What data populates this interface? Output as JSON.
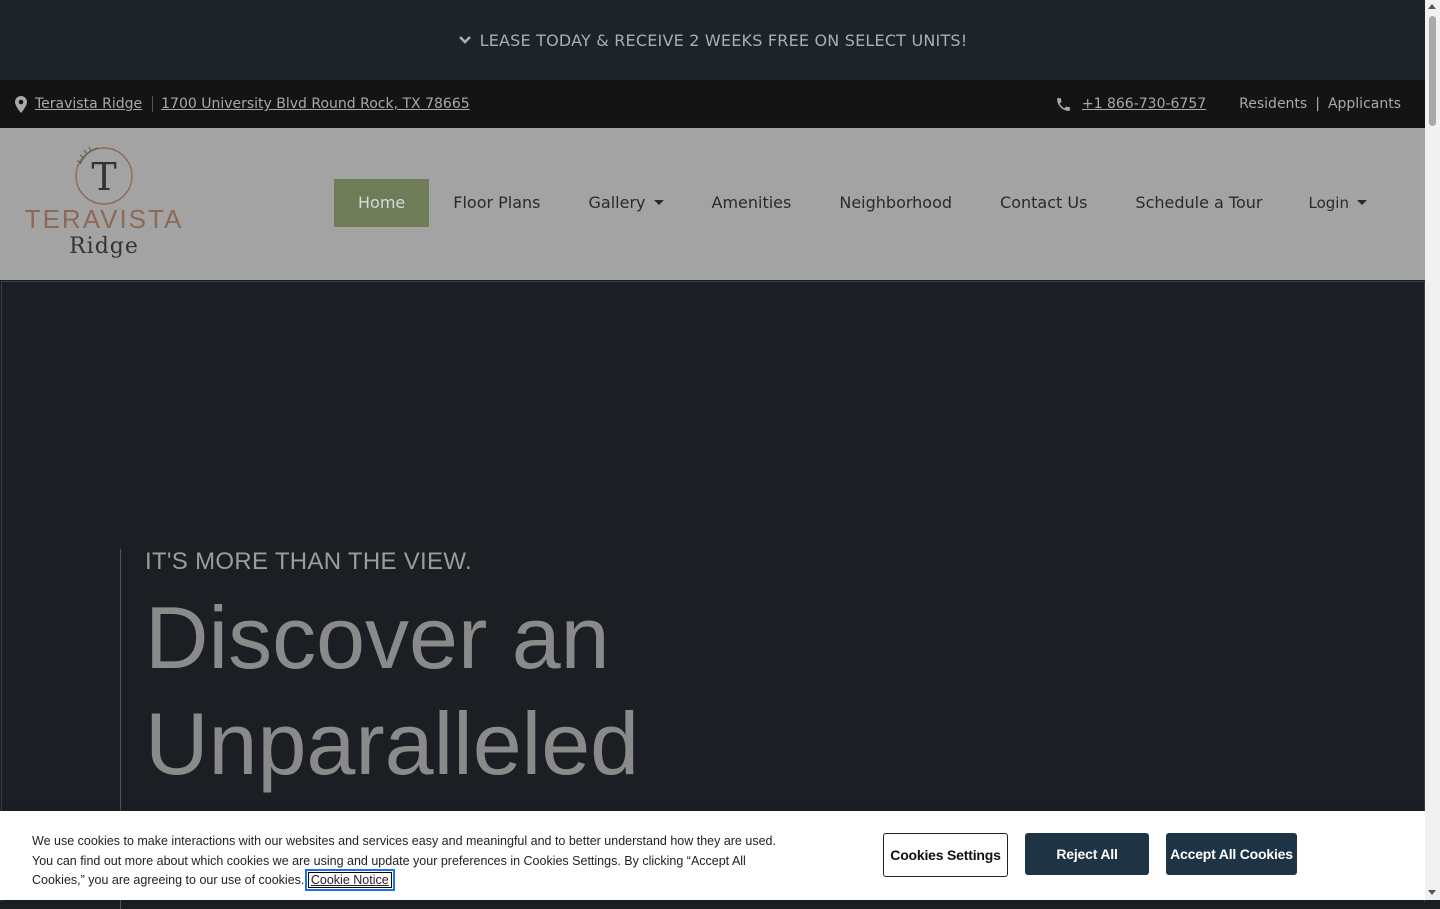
{
  "banner": {
    "text": "LEASE TODAY & RECEIVE 2 WEEKS FREE ON SELECT UNITS!",
    "icon": "chevron-down-icon"
  },
  "topbar": {
    "property_name": "Teravista Ridge",
    "address": "1700 University Blvd Round Rock, TX 78665",
    "phone": "+1 866-730-6757",
    "residents": "Residents",
    "separator": "|",
    "applicants": "Applicants"
  },
  "logo": {
    "line1": "TERAVISTA",
    "line2": "Ridge",
    "monogram": "T"
  },
  "nav": {
    "items": [
      {
        "label": "Home",
        "active": true
      },
      {
        "label": "Floor Plans"
      },
      {
        "label": "Gallery",
        "dropdown": true
      },
      {
        "label": "Amenities"
      },
      {
        "label": "Neighborhood"
      },
      {
        "label": "Contact Us"
      },
      {
        "label": "Schedule a Tour"
      }
    ],
    "login": "Login"
  },
  "hero": {
    "kicker": "IT'S MORE THAN THE VIEW.",
    "headline_line1": "Discover an",
    "headline_line2": "Unparalleled"
  },
  "cookie": {
    "text": "We use cookies to make interactions with our websites and services easy and meaningful and to better understand how they are used. You can find out more about which cookies we are using and update your preferences in Cookies Settings. By clicking “Accept All Cookies,” you are agreeing to our use of cookies.",
    "notice_link": "Cookie Notice",
    "settings_label": "Cookies Settings",
    "reject_label": "Reject All",
    "accept_label": "Accept All Cookies"
  },
  "colors": {
    "banner_bg": "#1d2328",
    "topbar_bg": "#141414",
    "nav_bg": "#a3a3a3",
    "nav_active": "#6e7d58",
    "hero_bg": "#1b1f23",
    "button_dark": "#1e3444"
  }
}
